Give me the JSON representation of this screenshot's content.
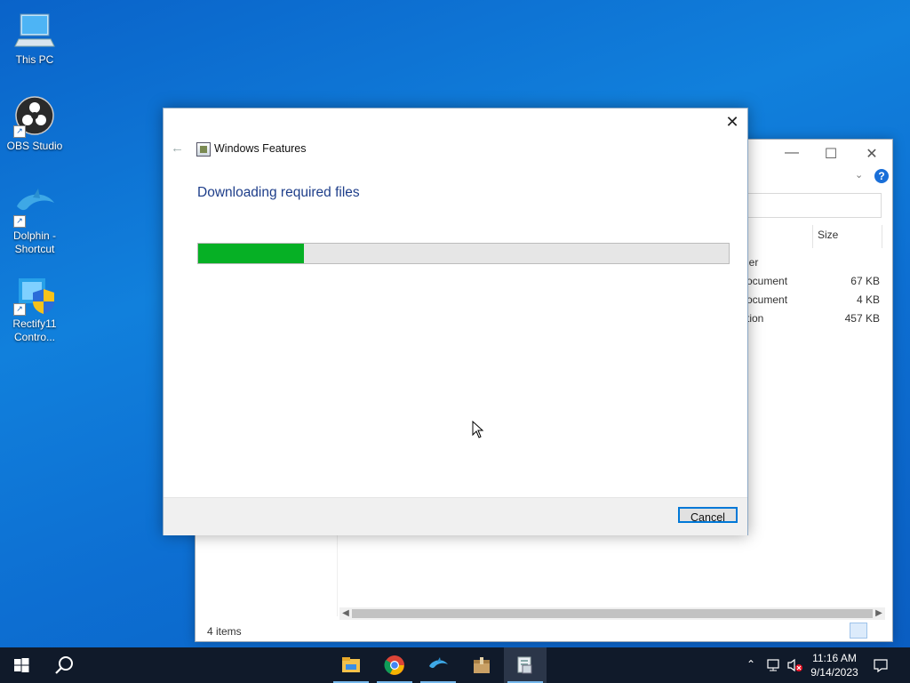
{
  "desktop": {
    "icons": [
      {
        "label": "This PC"
      },
      {
        "label": "OBS Studio"
      },
      {
        "label": "Dolphin - Shortcut"
      },
      {
        "label": "Rectify11 Contro..."
      }
    ]
  },
  "explorer": {
    "column_size": "Size",
    "rows": [
      {
        "type": "ler",
        "size": ""
      },
      {
        "type": "ocument",
        "size": "67 KB"
      },
      {
        "type": "ocument",
        "size": "4 KB"
      },
      {
        "type": "tion",
        "size": "457 KB"
      }
    ],
    "status": "4 items",
    "help_glyph": "?"
  },
  "dialog": {
    "title": "Windows Features",
    "heading": "Downloading required files",
    "progress_fraction": 0.2,
    "cancel_label": "Cancel",
    "close_glyph": "✕",
    "back_glyph": "←"
  },
  "taskbar": {
    "apps": [
      "file-explorer",
      "chrome",
      "dolphin",
      "package-app",
      "windows-features"
    ],
    "time": "11:16 AM",
    "date": "9/14/2023"
  },
  "colors": {
    "progress_fill": "#06b025",
    "accent": "#0078d7",
    "desktop": "#1180dc",
    "taskbar": "#101a2a"
  }
}
